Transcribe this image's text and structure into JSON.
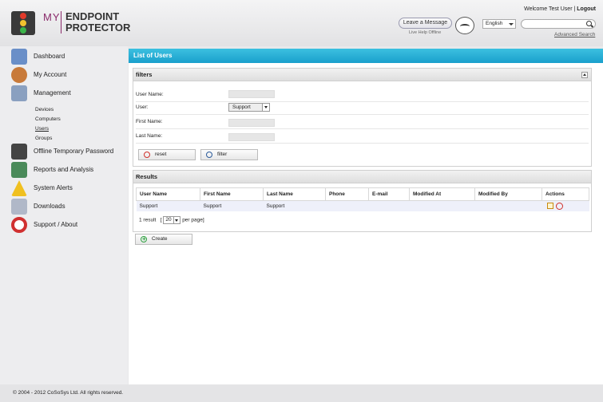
{
  "brand": {
    "my": "MY",
    "name": "ENDPOINT PROTECTOR"
  },
  "header": {
    "welcome": "Welcome Test User",
    "separator": "|",
    "logout": "Logout",
    "leave_message": "Leave a Message",
    "live_help": "Live Help Offline",
    "language": "English",
    "search_placeholder": "",
    "advanced_search": "Advanced Search"
  },
  "sidebar": {
    "items": [
      {
        "label": "Dashboard",
        "icon": "dashboard-icon",
        "color": "#6a8fc8"
      },
      {
        "label": "My Account",
        "icon": "account-icon",
        "color": "#c87a3a"
      },
      {
        "label": "Management",
        "icon": "management-icon",
        "color": "#8aa0c0"
      },
      {
        "label": "Offline Temporary Password",
        "icon": "password-icon",
        "color": "#444444"
      },
      {
        "label": "Reports and Analysis",
        "icon": "reports-icon",
        "color": "#4a8a5a"
      },
      {
        "label": "System Alerts",
        "icon": "alert-icon",
        "color": "#f0c020"
      },
      {
        "label": "Downloads",
        "icon": "downloads-icon",
        "color": "#b0b8c8"
      },
      {
        "label": "Support / About",
        "icon": "support-icon",
        "color": "#d03030"
      }
    ],
    "management_sub": [
      "Devices",
      "Computers",
      "Users",
      "Groups"
    ]
  },
  "main": {
    "title": "List of Users",
    "filters": {
      "title": "filters",
      "user_name_label": "User Name:",
      "user_label": "User:",
      "user_value": "Support",
      "first_name_label": "First Name:",
      "last_name_label": "Last Name:",
      "reset_label": "reset",
      "filter_label": "filter"
    },
    "results": {
      "title": "Results",
      "columns": [
        "User Name",
        "First Name",
        "Last Name",
        "Phone",
        "E-mail",
        "Modified At",
        "Modified By",
        "Actions"
      ],
      "rows": [
        [
          "Support",
          "Support",
          "Support",
          "",
          "",
          "",
          ""
        ]
      ],
      "count_text": "1 result",
      "open_bracket": "[",
      "per_page_value": "20",
      "per_page_text": "per page]"
    },
    "create_label": "Create"
  },
  "footer": "© 2004 - 2012 CoSoSys Ltd. All rights reserved."
}
